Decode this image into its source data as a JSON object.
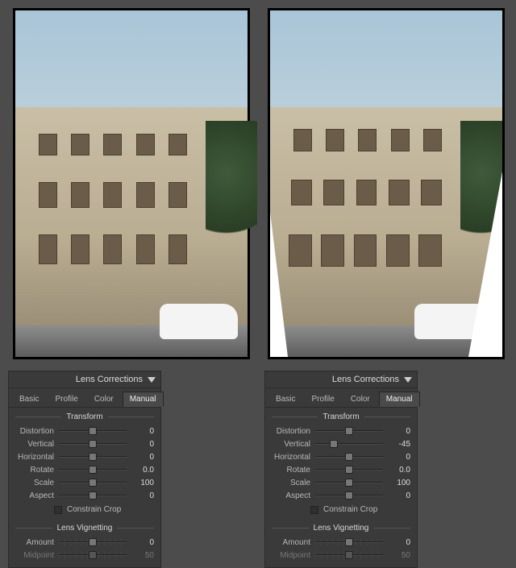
{
  "panelTitle": "Lens Corrections",
  "tabs": {
    "basic": "Basic",
    "profile": "Profile",
    "color": "Color",
    "manual": "Manual"
  },
  "sections": {
    "transform": "Transform",
    "vignetting": "Lens Vignetting"
  },
  "labels": {
    "distortion": "Distortion",
    "vertical": "Vertical",
    "horizontal": "Horizontal",
    "rotate": "Rotate",
    "scale": "Scale",
    "aspect": "Aspect",
    "constrainCrop": "Constrain Crop",
    "amount": "Amount",
    "midpoint": "Midpoint"
  },
  "left": {
    "transform": {
      "distortion": 0,
      "vertical": 0,
      "horizontal": 0,
      "rotate": "0.0",
      "scale": 100,
      "aspect": 0
    },
    "constrainCrop": false,
    "vignetting": {
      "amount": 0,
      "midpoint": 50
    }
  },
  "right": {
    "transform": {
      "distortion": 0,
      "vertical": -45,
      "horizontal": 0,
      "rotate": "0.0",
      "scale": 100,
      "aspect": 0
    },
    "constrainCrop": false,
    "vignetting": {
      "amount": 0,
      "midpoint": 50
    }
  }
}
